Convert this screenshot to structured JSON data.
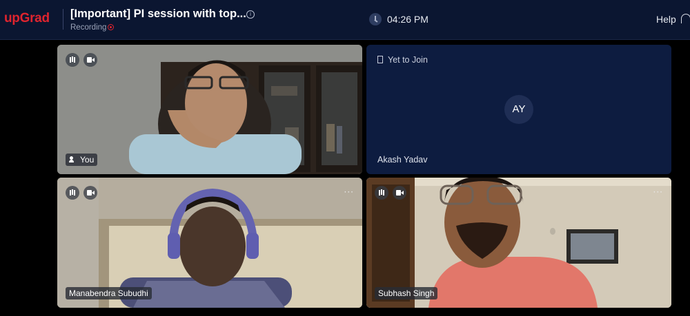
{
  "header": {
    "logo": "upGrad",
    "title": "[Important] PI session with top...",
    "info_icon": "info-icon",
    "recording_label": "Recording",
    "time": "04:26 PM",
    "help_label": "Help",
    "colors": {
      "brand": "#e0242e",
      "bar_bg": "#0b1631"
    }
  },
  "tiles": [
    {
      "name": "You",
      "video": true,
      "controls": [
        "mic-icon",
        "camera-icon"
      ],
      "badge_icon": "speaker-person-icon"
    },
    {
      "status": "Yet to Join",
      "initials": "AY",
      "name": "Akash Yadav",
      "video": false
    },
    {
      "name": "Manabendra Subudhi",
      "video": true,
      "controls": [
        "mic-icon",
        "camera-icon"
      ],
      "more": "···"
    },
    {
      "name": "Subhash Singh",
      "video": true,
      "controls": [
        "mic-icon",
        "camera-icon"
      ],
      "more": "···"
    }
  ]
}
